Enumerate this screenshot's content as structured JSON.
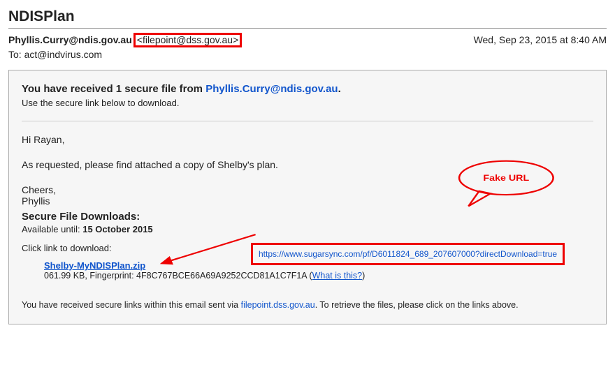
{
  "subject": "NDISPlan",
  "from_name": "Phyllis.Curry@ndis.gov.au",
  "from_address_bracketed": "<filepoint@dss.gov.au>",
  "date": "Wed, Sep 23, 2015 at 8:40 AM",
  "to_line": "To: act@indvirus.com",
  "body": {
    "received_prefix": "You have received 1 secure file from ",
    "received_sender": "Phyllis.Curry@ndis.gov.au",
    "received_suffix": ".",
    "use_link_text": "Use the secure link below to download.",
    "greeting": "Hi Rayan,",
    "line1": "As requested, please find attached a copy of Shelby's plan.",
    "cheers": "Cheers,",
    "sig_name": "Phyllis",
    "downloads_title": "Secure File Downloads:",
    "available_until_label": "Available until: ",
    "available_until_date": "15 October 2015",
    "click_hint": "Click link to download:",
    "download": {
      "filename": "Shelby-MyNDISPlan.zip",
      "size": "061.99 KB",
      "fingerprint_label": ", Fingerprint: ",
      "fingerprint": "4F8C767BCE66A69A9252CCD81A1C7F1A",
      "what_is_this": "What is this?"
    },
    "footer_prefix": "You have received secure links within this email sent via ",
    "footer_domain": "filepoint.dss.gov.au",
    "footer_suffix": ". To retrieve the files, please click on the links above."
  },
  "annotation": {
    "fake_url_label": "Fake URL",
    "revealed_url": "https://www.sugarsync.com/pf/D6011824_689_207607000?directDownload=true"
  }
}
